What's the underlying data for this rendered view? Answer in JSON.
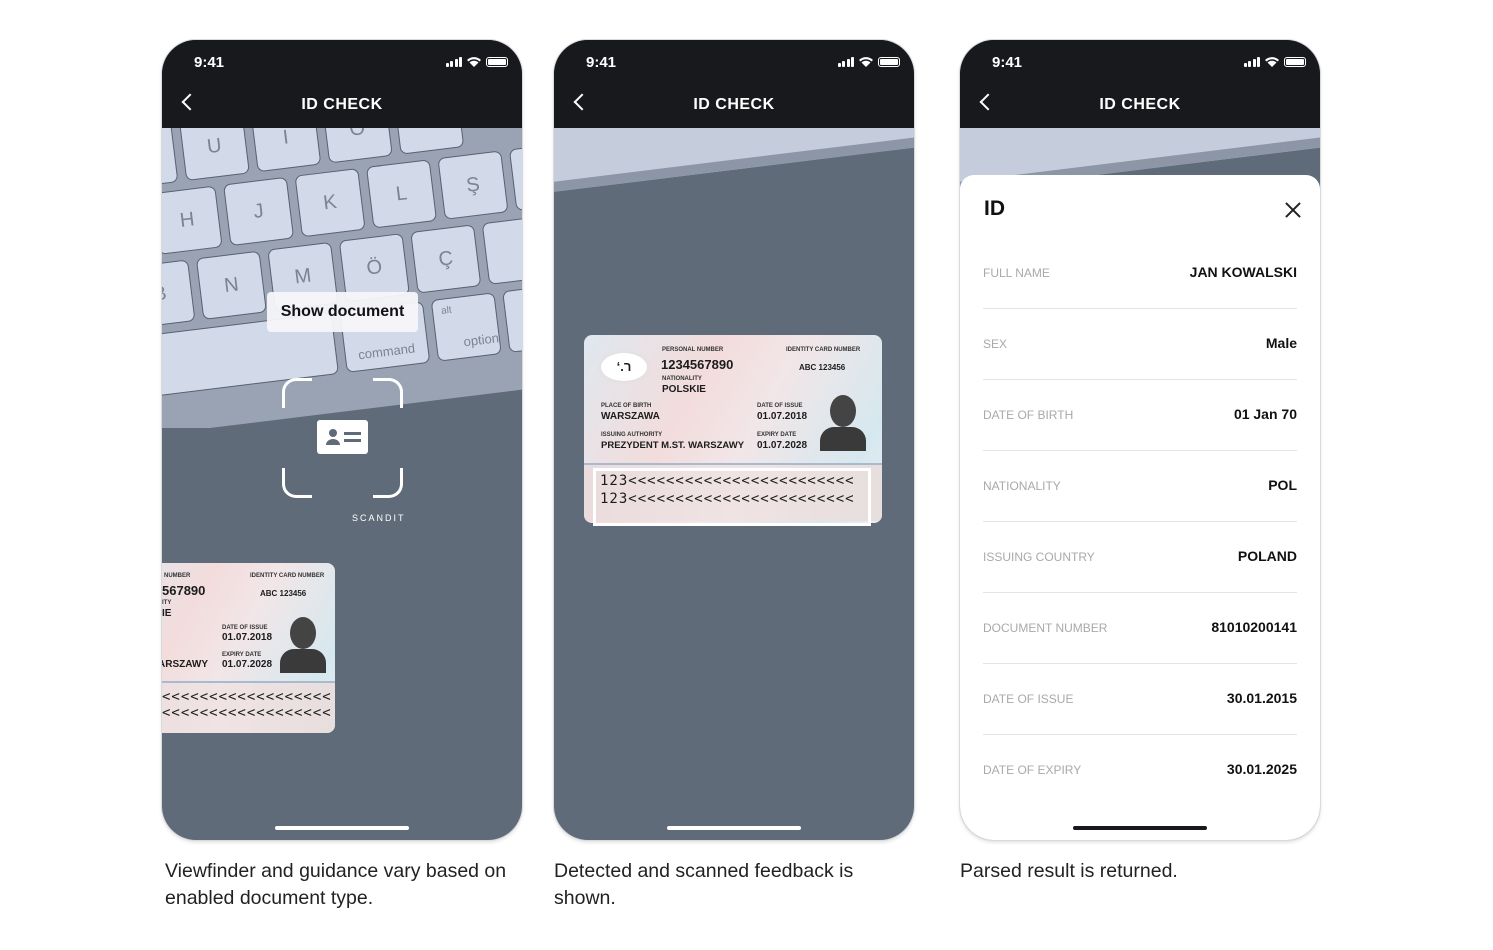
{
  "status_bar": {
    "time": "9:41"
  },
  "screens": [
    {
      "header": {
        "title": "ID CHECK"
      },
      "keyboard_keys": [
        "Y",
        "U",
        "I",
        "O",
        "H",
        "J",
        "K",
        "L",
        "Ş",
        "B",
        "N",
        "M",
        "Ö",
        "Ç",
        "command",
        "alt",
        "option"
      ],
      "toast": "Show document",
      "brand": "SCANDIT",
      "card": {
        "personal_number_label": "NUMBER",
        "personal_number": "567890",
        "nationality_label": "ITY",
        "nationality": "IE",
        "id_label": "IDENTITY CARD NUMBER",
        "id_number": "ABC 123456",
        "issue_label": "DATE OF ISSUE",
        "issue": "01.07.2018",
        "expiry_label": "EXPIRY DATE",
        "expiry": "01.07.2028",
        "authority": "ARSZAWY",
        "mrz1": "<<<<<<<<<<<<<<<<<<",
        "mrz2": "<<<<<<<<<<<<<<<<<<"
      },
      "caption": "Viewfinder and guidance vary based on enabled document type."
    },
    {
      "header": {
        "title": "ID CHECK"
      },
      "card": {
        "personal_number_label": "PERSONAL NUMBER",
        "personal_number": "1234567890",
        "nationality_label": "NATIONALITY",
        "nationality": "POLSKIE",
        "id_label": "IDENTITY CARD NUMBER",
        "id_number": "ABC 123456",
        "pob_label": "PLACE OF BIRTH",
        "pob": "WARSZAWA",
        "authority_label": "ISSUING AUTHORITY",
        "authority": "PREZYDENT M.ST. WARSZAWY",
        "issue_label": "DATE OF ISSUE",
        "issue": "01.07.2018",
        "expiry_label": "EXPIRY DATE",
        "expiry": "01.07.2028",
        "logo": "‘.ר",
        "mrz1": "123<<<<<<<<<<<<<<<<<<<<<<<<",
        "mrz2": "123<<<<<<<<<<<<<<<<<<<<<<<<"
      },
      "caption": "Detected and scanned feedback is shown."
    },
    {
      "header": {
        "title": "ID CHECK"
      },
      "sheet_title": "ID",
      "fields": [
        {
          "label": "FULL NAME",
          "value": "JAN KOWALSKI"
        },
        {
          "label": "SEX",
          "value": "Male"
        },
        {
          "label": "DATE OF BIRTH",
          "value": "01 Jan 70"
        },
        {
          "label": "NATIONALITY",
          "value": "POL"
        },
        {
          "label": "ISSUING COUNTRY",
          "value": "POLAND"
        },
        {
          "label": "DOCUMENT NUMBER",
          "value": "81010200141"
        },
        {
          "label": "DATE OF ISSUE",
          "value": "30.01.2015"
        },
        {
          "label": "DATE OF EXPIRY",
          "value": "30.01.2025"
        }
      ],
      "caption": "Parsed result is returned."
    }
  ]
}
